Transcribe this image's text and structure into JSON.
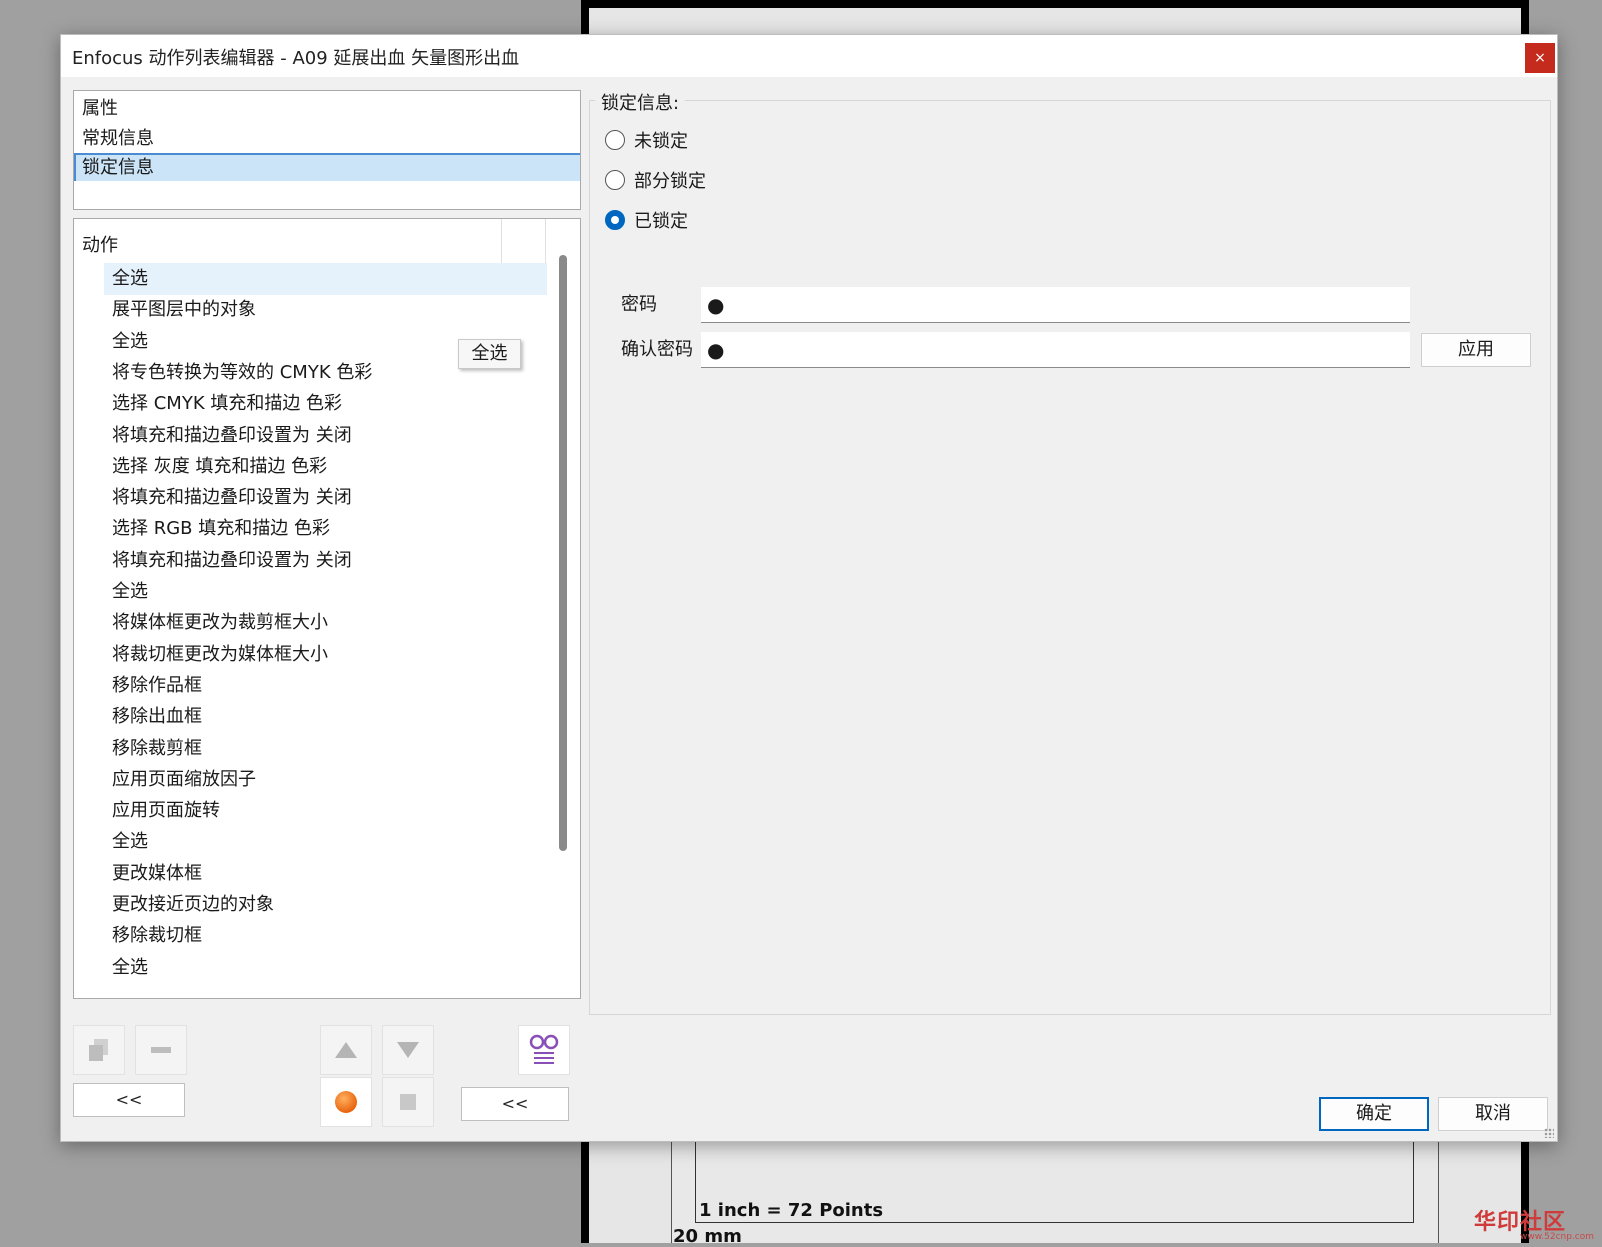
{
  "window": {
    "title": "Enfocus 动作列表编辑器 - A09 延展出血 矢量图形出血",
    "close_label": "×"
  },
  "background": {
    "scale_text": "1 inch = 72 Points",
    "size_text": "20 mm",
    "watermark": "华印社区",
    "watermark_url": "www.52cnp.com"
  },
  "prop_list": {
    "items": [
      {
        "label": "属性",
        "selected": false
      },
      {
        "label": "常规信息",
        "selected": false
      },
      {
        "label": "锁定信息",
        "selected": true
      }
    ]
  },
  "action_list": {
    "header": "动作",
    "items": [
      "全选",
      "展平图层中的对象",
      "全选",
      "将专色转换为等效的 CMYK 色彩",
      "选择 CMYK 填充和描边 色彩",
      "将填充和描边叠印设置为 关闭",
      "选择 灰度 填充和描边 色彩",
      "将填充和描边叠印设置为 关闭",
      "选择 RGB 填充和描边 色彩",
      "将填充和描边叠印设置为 关闭",
      "全选",
      "将媒体框更改为裁剪框大小",
      "将裁切框更改为媒体框大小",
      "移除作品框",
      "移除出血框",
      "移除裁剪框",
      "应用页面缩放因子",
      "应用页面旋转",
      "全选",
      "更改媒体框",
      "更改接近页边的对象",
      "移除裁切框",
      "全选"
    ],
    "tooltip": "全选"
  },
  "toolbar": {
    "collapse_left_label": "<<",
    "collapse_right_label": "<<"
  },
  "lock_panel": {
    "group_title": "锁定信息:",
    "options": [
      {
        "label": "未锁定",
        "checked": false
      },
      {
        "label": "部分锁定",
        "checked": false
      },
      {
        "label": "已锁定",
        "checked": true
      }
    ],
    "password_label": "密码",
    "password_value": "●",
    "confirm_label": "确认密码",
    "confirm_value": "●",
    "apply_label": "应用"
  },
  "footer": {
    "ok_label": "确定",
    "cancel_label": "取消"
  },
  "colors": {
    "accent": "#0067c0",
    "selection": "#cce4f7",
    "close": "#c42b1c",
    "record": "#e8620c"
  }
}
